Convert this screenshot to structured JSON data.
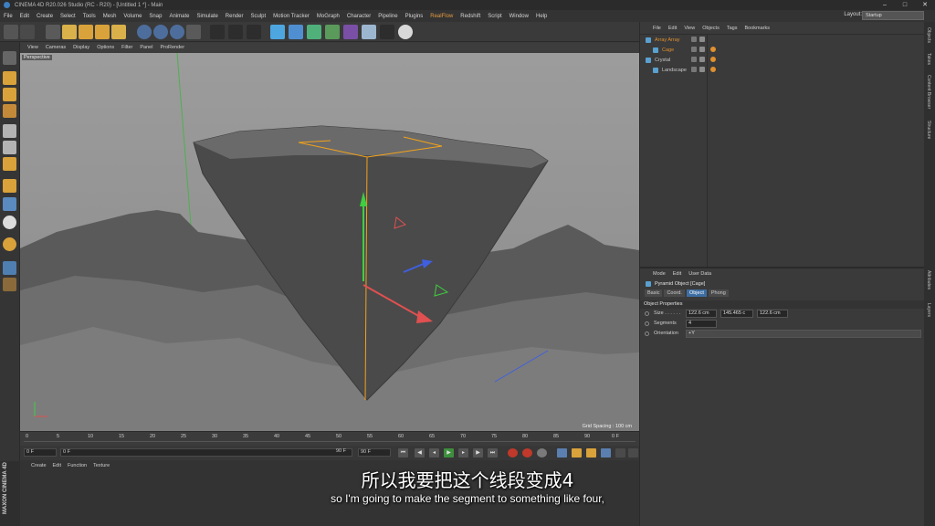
{
  "window": {
    "title": "CINEMA 4D R20.026 Studio (RC - R20) - [Untitled 1 *] - Main",
    "controls": [
      "–",
      "□",
      "✕"
    ]
  },
  "menubar": {
    "items": [
      "File",
      "Edit",
      "Create",
      "Select",
      "Tools",
      "Mesh",
      "Volume",
      "Snap",
      "Animate",
      "Simulate",
      "Render",
      "Sculpt",
      "Motion Tracker",
      "MoGraph",
      "Character",
      "Pipeline",
      "Plugins",
      "RealFlow",
      "Redshift",
      "Script",
      "Window",
      "Help"
    ],
    "layout_label": "Layout:",
    "layout_value": "Startup"
  },
  "viewport": {
    "menu": [
      "View",
      "Cameras",
      "Display",
      "Options",
      "Filter",
      "Panel",
      "ProRender"
    ],
    "label": "Perspective",
    "grid_spacing": "Grid Spacing : 100 cm"
  },
  "timeline": {
    "ticks": [
      "0",
      "5",
      "10",
      "15",
      "20",
      "25",
      "30",
      "35",
      "40",
      "45",
      "50",
      "55",
      "60",
      "65",
      "70",
      "75",
      "80",
      "85",
      "90"
    ],
    "end_field": "0 F"
  },
  "transport": {
    "start": "0 F",
    "current": "0 F",
    "end_slider": "90 F",
    "end": "90 F"
  },
  "material_menu": [
    "Create",
    "Edit",
    "Function",
    "Texture"
  ],
  "object_manager": {
    "menu": [
      "File",
      "Edit",
      "View",
      "Objects",
      "Tags",
      "Bookmarks"
    ],
    "objects": [
      {
        "name": "Array Array",
        "color": "#e0902e"
      },
      {
        "name": "Cage",
        "color": "#e0902e"
      },
      {
        "name": "Crystal",
        "color": "#cfcfcf"
      },
      {
        "name": "Landscape",
        "color": "#cfcfcf"
      }
    ]
  },
  "attributes": {
    "menu": [
      "Mode",
      "Edit",
      "User Data"
    ],
    "title": "Pyramid Object [Cage]",
    "tabs": [
      "Basic",
      "Coord.",
      "Object",
      "Phong"
    ],
    "active_tab": "Object",
    "section": "Object Properties",
    "size_label": "Size . . . . . .",
    "size_x": "122.6 cm",
    "size_y": "145.465 c",
    "size_z": "122.6 cm",
    "segments_label": "Segments",
    "segments_value": "4",
    "orientation_label": "Orientation",
    "orientation_value": "+Y"
  },
  "right_tabs": [
    "Objects",
    "Takes",
    "Content Browser",
    "Structure",
    "Attributes",
    "Layers"
  ],
  "brand": "MAXON CINEMA 4D",
  "subtitles": {
    "zh": "所以我要把这个线段变成4",
    "en": "so I'm going to make the segment to something like four,"
  }
}
